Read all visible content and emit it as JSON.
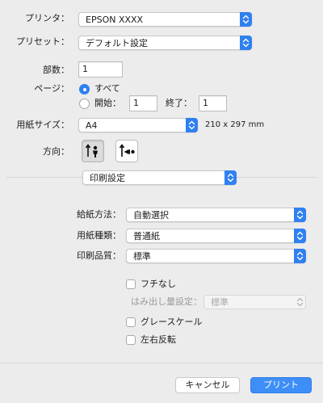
{
  "printer": {
    "label": "プリンタ：",
    "value": "EPSON XXXX"
  },
  "preset": {
    "label": "プリセット：",
    "value": "デフォルト設定"
  },
  "copies": {
    "label": "部数：",
    "value": "1"
  },
  "pages": {
    "label": "ページ：",
    "all_label": "すべて",
    "from_label": "開始：",
    "from_value": "1",
    "to_label": "終了：",
    "to_value": "1",
    "selected": "all"
  },
  "paper_size": {
    "label": "用紙サイズ：",
    "value": "A4",
    "dimensions": "210 x 297 mm"
  },
  "orientation": {
    "label": "方向：",
    "selected": "portrait"
  },
  "section": {
    "value": "印刷設定"
  },
  "paper_source": {
    "label": "給紙方法：",
    "value": "自動選択"
  },
  "media_type": {
    "label": "用紙種類：",
    "value": "普通紙"
  },
  "print_quality": {
    "label": "印刷品質：",
    "value": "標準"
  },
  "borderless": {
    "label": "フチなし",
    "checked": false
  },
  "expansion": {
    "label": "はみ出し量設定：",
    "value": "標準",
    "enabled": false
  },
  "grayscale": {
    "label": "グレースケール",
    "checked": false
  },
  "mirror": {
    "label": "左右反転",
    "checked": false
  },
  "buttons": {
    "cancel": "キャンセル",
    "print": "プリント"
  },
  "colors": {
    "accent": "#2f80f0",
    "primary_button": "#3e8ef7"
  }
}
